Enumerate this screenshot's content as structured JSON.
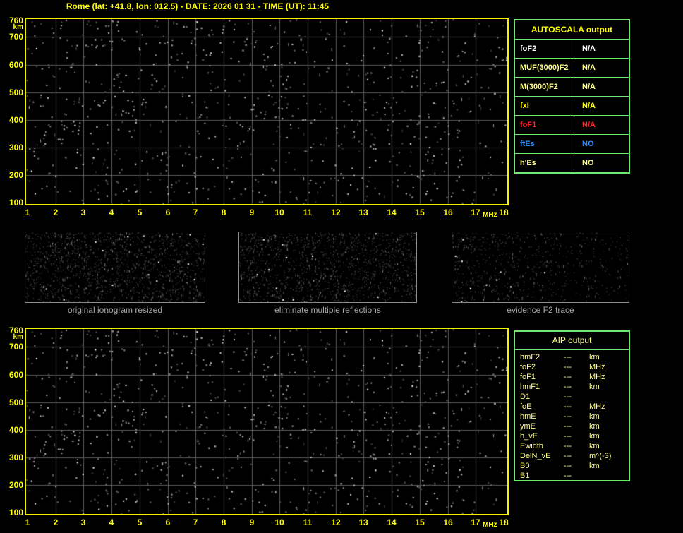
{
  "window": {
    "title": "Rome (lat: +41.8, lon: 012.5) - DATE: 2026 01 31 - TIME (UT): 11:45"
  },
  "colors": {
    "background": "#000000",
    "accent_yellow": "#ffff00",
    "pale_yellow": "#ffff8c",
    "white": "#ffffff",
    "red": "#ff2121",
    "blue": "#2a8cff",
    "table_green": "#6ee86e",
    "caption_gray": "#a8a8a8",
    "grid_gray": "#5a5a5a",
    "thumb_border_gray": "#8c8c8c"
  },
  "ionogram": {
    "x_unit": "MHz",
    "y_unit": "km",
    "x_ticks": [
      "1",
      "2",
      "3",
      "4",
      "5",
      "6",
      "7",
      "8",
      "9",
      "10",
      "11",
      "12",
      "13",
      "14",
      "15",
      "16",
      "17",
      "18"
    ],
    "y_ticks": [
      "760",
      "700",
      "600",
      "500",
      "400",
      "300",
      "200",
      "100"
    ],
    "x_range": [
      1,
      18
    ],
    "y_range": [
      100,
      760
    ]
  },
  "autoscala": {
    "header": "AUTOSCALA output",
    "rows": [
      {
        "label": "foF2",
        "value": "N/A",
        "color": "#ffffff"
      },
      {
        "label": "MUF(3000)F2",
        "value": "N/A",
        "color": "#ffff8c"
      },
      {
        "label": "M(3000)F2",
        "value": "N/A",
        "color": "#ffff8c"
      },
      {
        "label": "fxI",
        "value": "N/A",
        "color": "#ffff00"
      },
      {
        "label": "foF1",
        "value": "N/A",
        "color": "#ff2121"
      },
      {
        "label": "ftEs",
        "value": "NO",
        "color": "#2a8cff"
      },
      {
        "label": "h'Es",
        "value": "NO",
        "color": "#ffff8c"
      }
    ]
  },
  "thumbnails": {
    "items": [
      {
        "caption": "original ionogram resized",
        "seed": 101,
        "dots": 1500,
        "bright_dots": 14,
        "falloff": 0
      },
      {
        "caption": "eliminate multiple reflections",
        "seed": 202,
        "dots": 1400,
        "bright_dots": 12,
        "falloff": 0
      },
      {
        "caption": "evidence F2 trace",
        "seed": 303,
        "dots": 1050,
        "bright_dots": 10,
        "falloff": 1
      }
    ]
  },
  "aip": {
    "header": "AIP output",
    "rows": [
      {
        "label": "hmF2",
        "value": "---",
        "unit": "km"
      },
      {
        "label": "foF2",
        "value": "---",
        "unit": "MHz"
      },
      {
        "label": "foF1",
        "value": "---",
        "unit": "MHz"
      },
      {
        "label": "hmF1",
        "value": "---",
        "unit": "km"
      },
      {
        "label": "D1",
        "value": "---",
        "unit": ""
      },
      {
        "label": "foE",
        "value": "---",
        "unit": "MHz"
      },
      {
        "label": "hmE",
        "value": "---",
        "unit": "km"
      },
      {
        "label": "ymE",
        "value": "---",
        "unit": "km"
      },
      {
        "label": "h_vE",
        "value": "---",
        "unit": "km"
      },
      {
        "label": "Ewidth",
        "value": "---",
        "unit": "km"
      },
      {
        "label": "DelN_vE",
        "value": "---",
        "unit": "m^(-3)"
      },
      {
        "label": "B0",
        "value": "---",
        "unit": "km"
      },
      {
        "label": "B1",
        "value": "---",
        "unit": ""
      }
    ]
  },
  "noise": {
    "plot_seed": 20260131,
    "plot_dots": 880
  }
}
